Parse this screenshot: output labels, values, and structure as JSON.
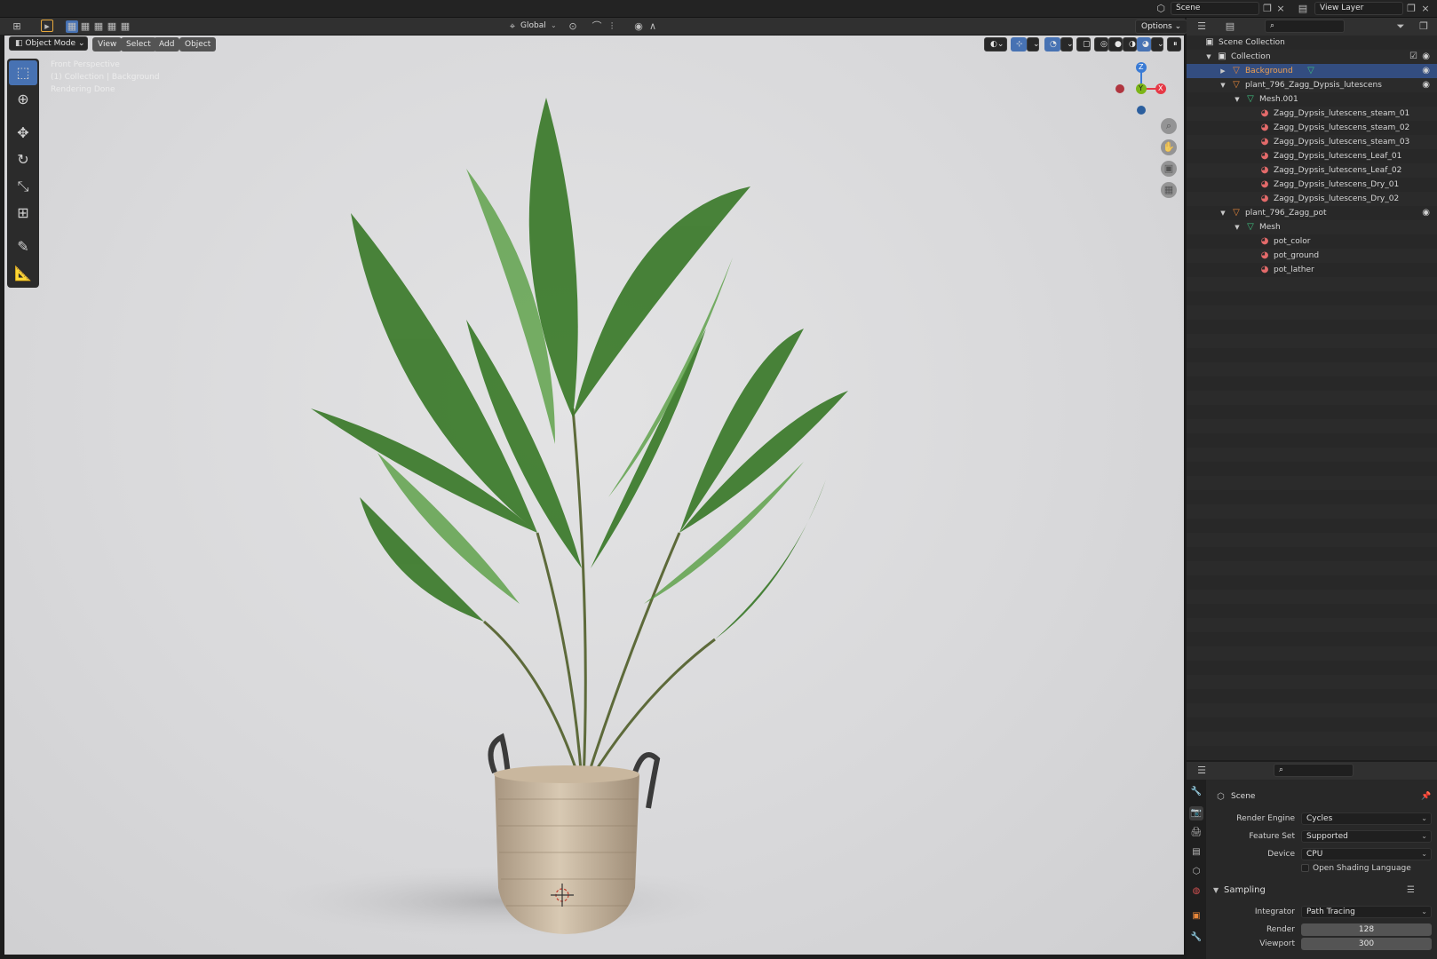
{
  "topbar": {
    "scene_label": "Scene",
    "view_layer_label": "View Layer"
  },
  "viewport_header": {
    "transform_orientation": "Global",
    "options_label": "Options",
    "mode": "Object Mode",
    "menus": [
      "View",
      "Select",
      "Add",
      "Object"
    ]
  },
  "viewport": {
    "info": [
      "Front Perspective",
      "(1) Collection | Background",
      "Rendering Done"
    ],
    "axes": {
      "z": "Z",
      "y": "Y",
      "x": "X"
    }
  },
  "outliner": {
    "rows": [
      {
        "label": "Scene Collection"
      },
      {
        "label": "Collection"
      },
      {
        "label": "Background"
      },
      {
        "label": "plant_796_Zagg_Dypsis_lutescens"
      },
      {
        "label": "Mesh.001"
      },
      {
        "label": "Zagg_Dypsis_lutescens_steam_01"
      },
      {
        "label": "Zagg_Dypsis_lutescens_steam_02"
      },
      {
        "label": "Zagg_Dypsis_lutescens_steam_03"
      },
      {
        "label": "Zagg_Dypsis_lutescens_Leaf_01"
      },
      {
        "label": "Zagg_Dypsis_lutescens_Leaf_02"
      },
      {
        "label": "Zagg_Dypsis_lutescens_Dry_01"
      },
      {
        "label": "Zagg_Dypsis_lutescens_Dry_02"
      },
      {
        "label": "plant_796_Zagg_pot"
      },
      {
        "label": "Mesh"
      },
      {
        "label": "pot_color"
      },
      {
        "label": "pot_ground"
      },
      {
        "label": "pot_lather"
      }
    ]
  },
  "properties": {
    "context": "Scene",
    "render_engine_label": "Render Engine",
    "render_engine": "Cycles",
    "feature_set_label": "Feature Set",
    "feature_set": "Supported",
    "device_label": "Device",
    "device": "CPU",
    "osl_label": "Open Shading Language",
    "sampling_label": "Sampling",
    "integrator_label": "Integrator",
    "integrator": "Path Tracing",
    "render_label": "Render",
    "render_samples": "128",
    "viewport_label": "Viewport",
    "viewport_samples": "300"
  },
  "colors": {
    "selection": "#334d80",
    "active_tool": "#4772b3",
    "axis_x": "#e63946",
    "axis_y": "#7cb518",
    "axis_z": "#3a7bd5",
    "object_icon": "#e8873a",
    "mesh_icon": "#3fbf7f",
    "material_icon": "#e36a6a"
  }
}
